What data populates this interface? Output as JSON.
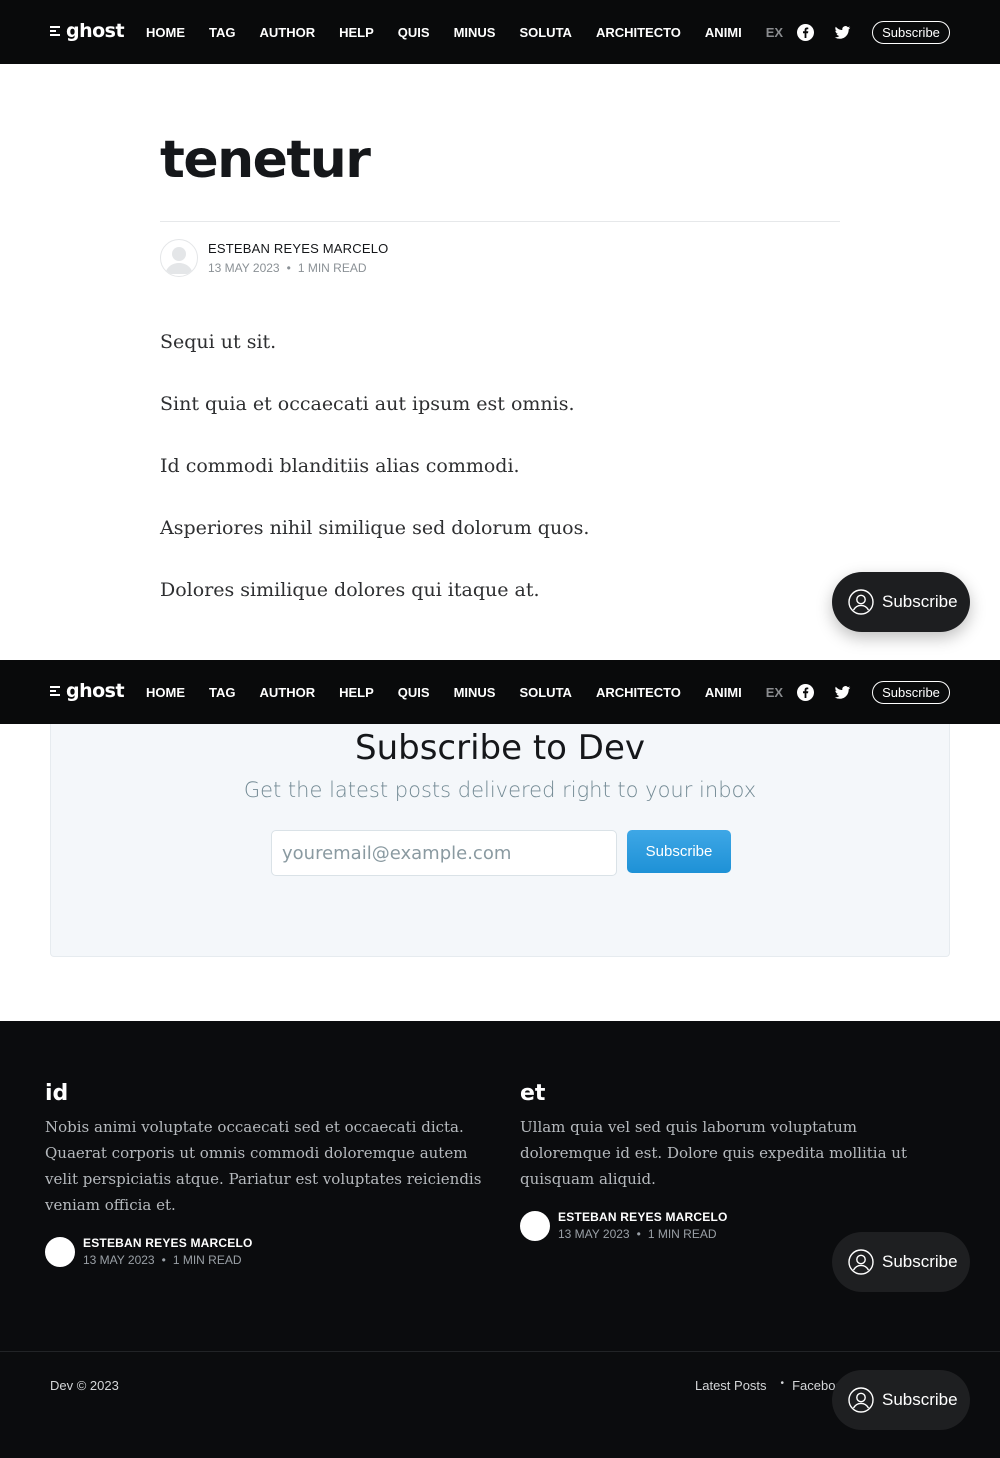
{
  "nav": {
    "logo_text": "ghost",
    "items": [
      "HOME",
      "TAG",
      "AUTHOR",
      "HELP",
      "QUIS",
      "MINUS",
      "SOLUTA",
      "ARCHITECTO",
      "ANIMI",
      "EX"
    ],
    "social": [
      "facebook-icon",
      "twitter-icon"
    ],
    "subscribe_label": "Subscribe"
  },
  "article": {
    "title": "tenetur",
    "author": "ESTEBAN REYES MARCELO",
    "date": "13 MAY 2023",
    "read_time": "1 MIN READ",
    "paragraphs": [
      "Sequi ut sit.",
      "Sint quia et occaecati aut ipsum est omnis.",
      "Id commodi blanditiis alias commodi.",
      "Asperiores nihil similique sed dolorum quos.",
      "Dolores similique dolores qui itaque at."
    ]
  },
  "subscribe_box": {
    "title": "Subscribe to Dev",
    "subtitle": "Get the latest posts delivered right to your inbox",
    "placeholder": "youremail@example.com",
    "button_label": "Subscribe"
  },
  "related": [
    {
      "title": "id",
      "excerpt": "Nobis animi voluptate occaecati sed et occaecati dicta. Quaerat corporis ut omnis commodi doloremque autem velit perspiciatis atque. Pariatur est voluptates reiciendis veniam officia et.",
      "author": "ESTEBAN REYES MARCELO",
      "date": "13 MAY 2023",
      "read_time": "1 MIN READ"
    },
    {
      "title": "et",
      "excerpt": "Ullam quia vel sed quis laborum voluptatum doloremque id est. Dolore quis expedita mollitia ut quisquam aliquid.",
      "author": "ESTEBAN REYES MARCELO",
      "date": "13 MAY 2023",
      "read_time": "1 MIN READ"
    }
  ],
  "footer": {
    "copyright": "Dev © 2023",
    "links": [
      "Latest Posts",
      "Facebook"
    ]
  },
  "floating_subscribe": {
    "label": "Subscribe"
  }
}
